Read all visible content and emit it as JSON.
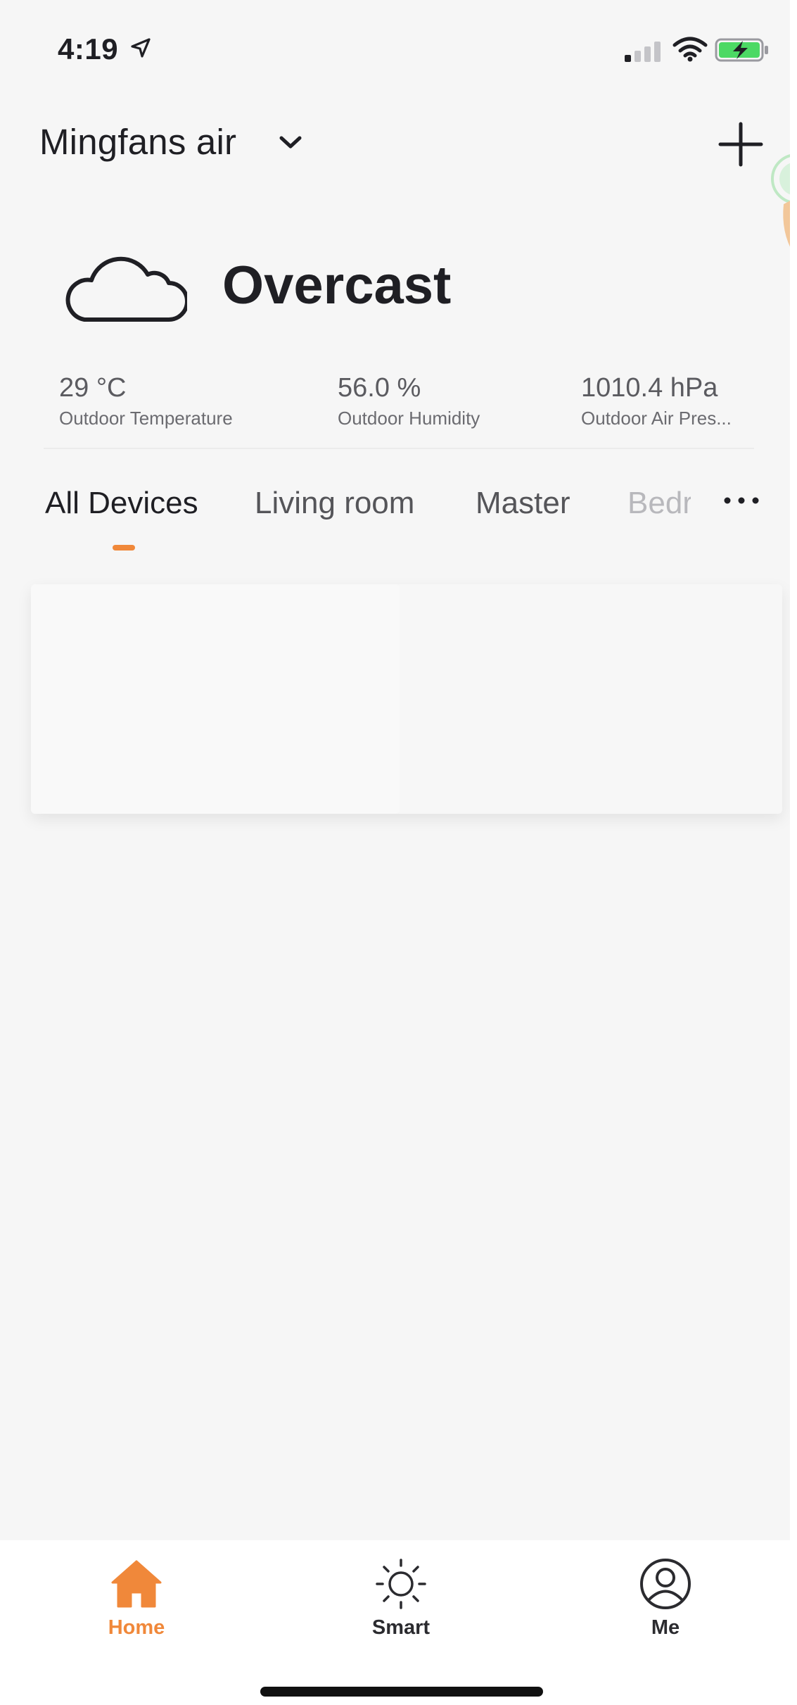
{
  "status_bar": {
    "time": "4:19",
    "location_icon": "location-arrow-icon",
    "signal_icon": "cellular-signal-icon",
    "wifi_icon": "wifi-icon",
    "battery_icon": "battery-charging-icon",
    "battery_color": "#4cd964"
  },
  "header": {
    "home_name": "Mingfans air",
    "chevron_icon": "chevron-down-icon",
    "add_icon": "plus-icon"
  },
  "weather": {
    "icon": "cloud-icon",
    "condition": "Overcast",
    "stats": [
      {
        "value": "29 °C",
        "label": "Outdoor Temperature"
      },
      {
        "value": "56.0 %",
        "label": "Outdoor Humidity"
      },
      {
        "value": "1010.4 hPa",
        "label": "Outdoor Air Pres..."
      }
    ]
  },
  "tabs": {
    "items": [
      {
        "label": "All Devices",
        "active": true
      },
      {
        "label": "Living room",
        "active": false
      },
      {
        "label": "Master",
        "active": false
      },
      {
        "label": "Bedr",
        "active": false
      }
    ],
    "more_icon": "more-dots-icon"
  },
  "bottom_nav": {
    "items": [
      {
        "label": "Home",
        "icon": "home-icon",
        "active": true
      },
      {
        "label": "Smart",
        "icon": "sun-icon",
        "active": false
      },
      {
        "label": "Me",
        "icon": "user-circle-icon",
        "active": false
      }
    ]
  },
  "colors": {
    "accent": "#f0883a",
    "background": "#f6f6f6",
    "text": "#1f1f24"
  }
}
